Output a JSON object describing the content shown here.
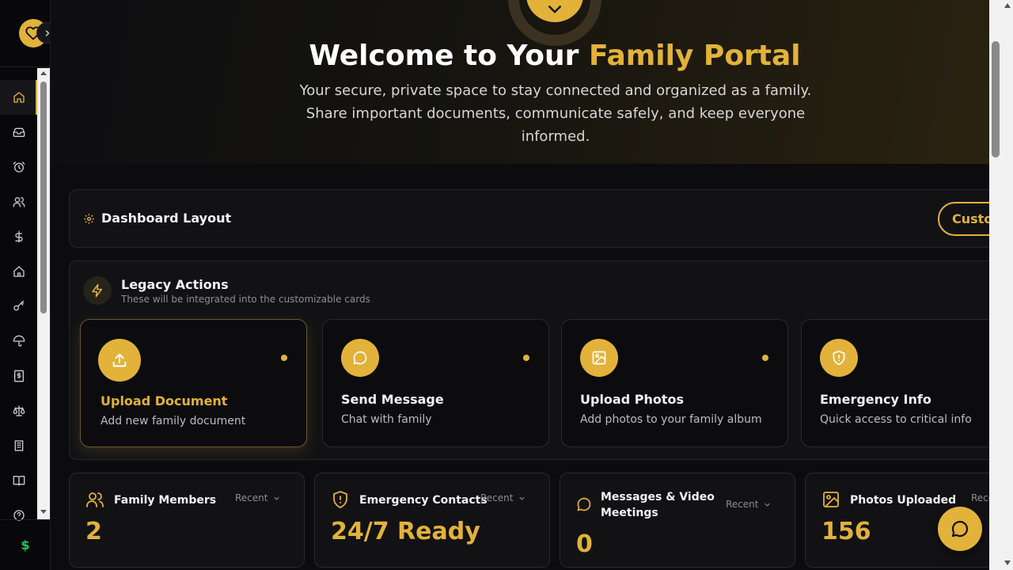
{
  "hero": {
    "title_main": "Welcome to Your",
    "title_accent": "Family Portal",
    "subtitle": "Your secure, private space to stay connected and organized as a family. Share important documents, communicate safely, and keep everyone informed."
  },
  "dashboard_layout": {
    "title": "Dashboard Layout",
    "customize_label": "Customize"
  },
  "legacy": {
    "title": "Legacy Actions",
    "subtitle": "These will be integrated into the customizable cards",
    "actions": [
      {
        "title": "Upload Document",
        "desc": "Add new family document",
        "icon": "upload-icon"
      },
      {
        "title": "Send Message",
        "desc": "Chat with family",
        "icon": "message-icon"
      },
      {
        "title": "Upload Photos",
        "desc": "Add photos to your family album",
        "icon": "image-icon"
      },
      {
        "title": "Emergency Info",
        "desc": "Quick access to critical info",
        "icon": "shield-icon"
      }
    ]
  },
  "stats": [
    {
      "label": "Family Members",
      "filter": "Recent",
      "value": "2",
      "icon": "users-icon"
    },
    {
      "label": "Emergency Contacts",
      "filter": "Recent",
      "value": "24/7 Ready",
      "icon": "shield-alert-icon"
    },
    {
      "label": "Messages & Video Meetings",
      "filter": "Recent",
      "value": "0",
      "icon": "message-icon"
    },
    {
      "label": "Photos Uploaded",
      "filter": "Recent",
      "value": "156",
      "icon": "image-icon"
    }
  ],
  "sidebar": {
    "items": [
      "home-icon",
      "inbox-icon",
      "alarm-icon",
      "users-icon",
      "dollar-icon",
      "house-icon",
      "key-icon",
      "umbrella-icon",
      "receipt-icon",
      "scale-icon",
      "bank-icon",
      "book-icon",
      "help-icon"
    ],
    "bottom_symbol": "$"
  },
  "colors": {
    "accent": "#e2b23a",
    "background": "#0c0c0f",
    "card": "#121215",
    "green": "#22c55e"
  }
}
